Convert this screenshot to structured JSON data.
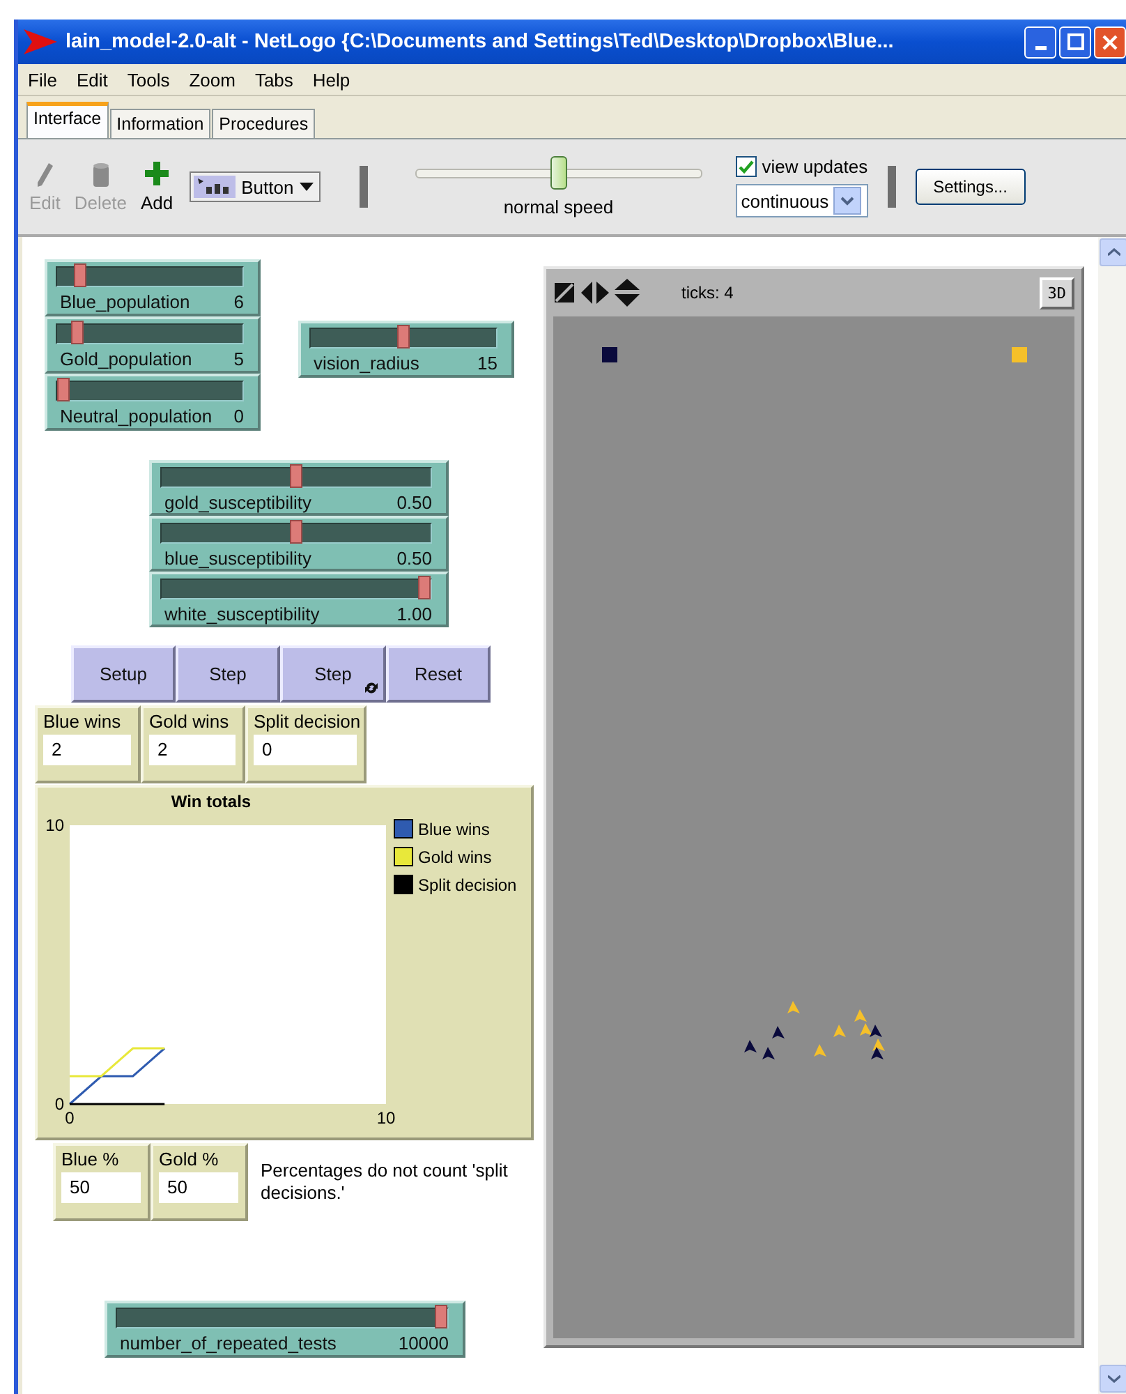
{
  "window": {
    "title": "lain_model-2.0-alt - NetLogo {C:\\Documents and Settings\\Ted\\Desktop\\Dropbox\\Blue..."
  },
  "menu": [
    "File",
    "Edit",
    "Tools",
    "Zoom",
    "Tabs",
    "Help"
  ],
  "tabs": [
    {
      "label": "Interface",
      "selected": true
    },
    {
      "label": "Information",
      "selected": false
    },
    {
      "label": "Procedures",
      "selected": false
    }
  ],
  "toolbar": {
    "tools": [
      {
        "kind": "edit",
        "label": "Edit",
        "disabled": true
      },
      {
        "kind": "delete",
        "label": "Delete",
        "disabled": true
      },
      {
        "kind": "add",
        "label": "Add",
        "disabled": false
      }
    ],
    "widget_type": "Button",
    "speed": {
      "label": "normal speed",
      "level": 0.5
    },
    "view_updates": {
      "label": "view updates",
      "checked": true
    },
    "update_mode": "continuous",
    "settings": "Settings..."
  },
  "sliders": [
    {
      "name": "Blue_population",
      "value": "6",
      "level": 0.1
    },
    {
      "name": "Gold_population",
      "value": "5",
      "level": 0.08
    },
    {
      "name": "Neutral_population",
      "value": "0",
      "level": 0
    },
    {
      "name": "vision_radius",
      "value": "15",
      "level": 0.5
    },
    {
      "name": "gold_susceptibility",
      "value": "0.50",
      "level": 0.5
    },
    {
      "name": "blue_susceptibility",
      "value": "0.50",
      "level": 0.5
    },
    {
      "name": "white_susceptibility",
      "value": "1.00",
      "level": 1
    },
    {
      "name": "number_of_repeated_tests",
      "value": "10000",
      "level": 1
    }
  ],
  "buttons": [
    {
      "label": "Setup",
      "forever": false
    },
    {
      "label": "Step",
      "forever": false
    },
    {
      "label": "Step",
      "forever": true
    },
    {
      "label": "Reset",
      "forever": false
    }
  ],
  "monitors": [
    {
      "label": "Blue wins",
      "value": "2"
    },
    {
      "label": "Gold wins",
      "value": "2"
    },
    {
      "label": "Split decision",
      "value": "0"
    },
    {
      "label": "Blue %",
      "value": "50"
    },
    {
      "label": "Gold %",
      "value": "50"
    }
  ],
  "plot": {
    "chart_data": {
      "type": "line",
      "title": "Win totals",
      "legend": true,
      "x": [
        0,
        1,
        2,
        3
      ],
      "xlim": [
        0,
        10
      ],
      "ylim": [
        0,
        10
      ],
      "xticks": [
        0,
        10
      ],
      "yticks": [
        0,
        10
      ],
      "series": [
        {
          "name": "Blue wins",
          "color": "#2f5bb0",
          "values": [
            0,
            1,
            1,
            2
          ]
        },
        {
          "name": "Gold wins",
          "color": "#e8e83a",
          "values": [
            1,
            1,
            2,
            2
          ]
        },
        {
          "name": "Split decision",
          "color": "#000000",
          "values": [
            0,
            0,
            0,
            0
          ]
        }
      ]
    }
  },
  "note": "Percentages do not count 'split decisions.'",
  "view": {
    "ticks": "ticks: 4",
    "three_d": "3D"
  }
}
